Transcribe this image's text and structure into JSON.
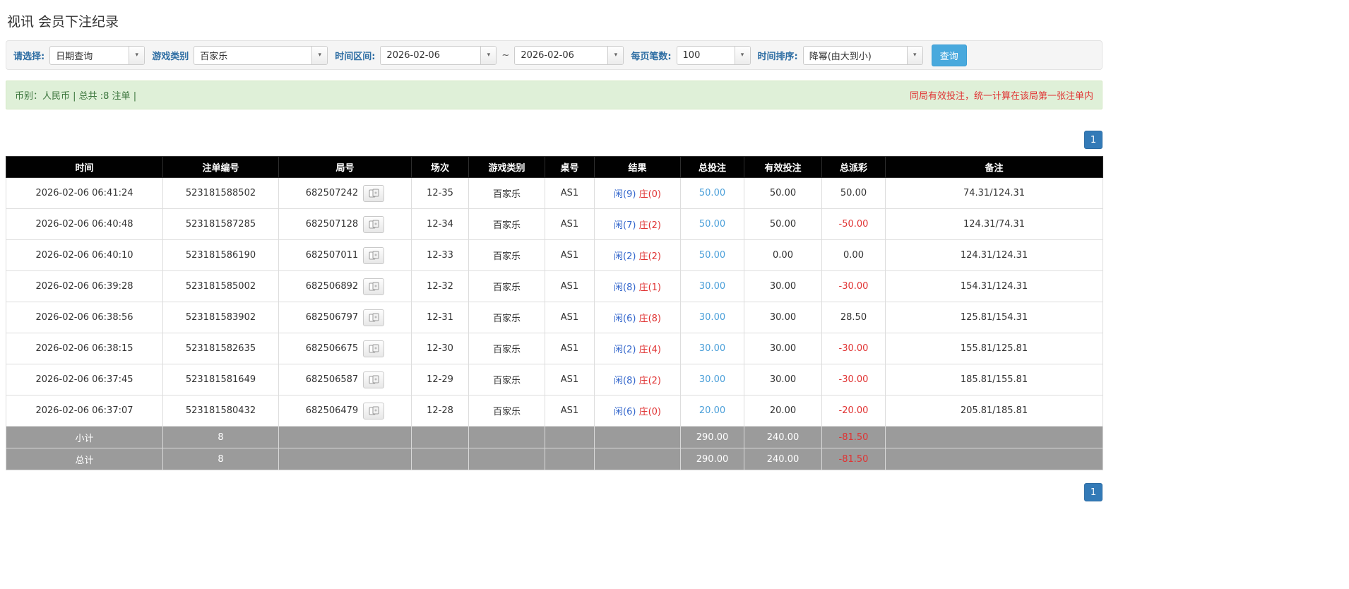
{
  "page": {
    "title": "视讯 会员下注纪录"
  },
  "filters": {
    "select_label": "请选择:",
    "select_value": "日期查询",
    "game_type_label": "游戏类别",
    "game_type_value": "百家乐",
    "date_range_label": "时间区间:",
    "date_from": "2026-02-06",
    "date_separator": "~",
    "date_to": "2026-02-06",
    "page_size_label": "每页笔数:",
    "page_size_value": "100",
    "sort_label": "时间排序:",
    "sort_value": "降幂(由大到小)",
    "search_button": "查询"
  },
  "summary": {
    "currency_info": "币别：人民币 | 总共 :8 注单 |",
    "note": "同局有效投注，统一计算在该局第一张注单内"
  },
  "pagination": {
    "page": "1"
  },
  "table": {
    "headers": [
      "时间",
      "注单编号",
      "局号",
      "场次",
      "游戏类别",
      "桌号",
      "结果",
      "总投注",
      "有效投注",
      "总派彩",
      "备注"
    ],
    "rows": [
      {
        "time": "2026-02-06 06:41:24",
        "bet_id": "523181588502",
        "round_id": "682507242",
        "session": "12-35",
        "game": "百家乐",
        "table_no": "AS1",
        "result_player": "闲(9)",
        "result_banker": "庄(0)",
        "total_bet": "50.00",
        "valid_bet": "50.00",
        "payout": "50.00",
        "note": "74.31/124.31",
        "highlighted": false
      },
      {
        "time": "2026-02-06 06:40:48",
        "bet_id": "523181587285",
        "round_id": "682507128",
        "session": "12-34",
        "game": "百家乐",
        "table_no": "AS1",
        "result_player": "闲(7)",
        "result_banker": "庄(2)",
        "total_bet": "50.00",
        "valid_bet": "50.00",
        "payout": "-50.00",
        "note": "124.31/74.31",
        "highlighted": false
      },
      {
        "time": "2026-02-06 06:40:10",
        "bet_id": "523181586190",
        "round_id": "682507011",
        "session": "12-33",
        "game": "百家乐",
        "table_no": "AS1",
        "result_player": "闲(2)",
        "result_banker": "庄(2)",
        "total_bet": "50.00",
        "valid_bet": "0.00",
        "payout": "0.00",
        "note": "124.31/124.31",
        "highlighted": false
      },
      {
        "time": "2026-02-06 06:39:28",
        "bet_id": "523181585002",
        "round_id": "682506892",
        "session": "12-32",
        "game": "百家乐",
        "table_no": "AS1",
        "result_player": "闲(8)",
        "result_banker": "庄(1)",
        "total_bet": "30.00",
        "valid_bet": "30.00",
        "payout": "-30.00",
        "note": "154.31/124.31",
        "highlighted": false
      },
      {
        "time": "2026-02-06 06:38:56",
        "bet_id": "523181583902",
        "round_id": "682506797",
        "session": "12-31",
        "game": "百家乐",
        "table_no": "AS1",
        "result_player": "闲(6)",
        "result_banker": "庄(8)",
        "total_bet": "30.00",
        "valid_bet": "30.00",
        "payout": "28.50",
        "note": "125.81/154.31",
        "highlighted": false
      },
      {
        "time": "2026-02-06 06:38:15",
        "bet_id": "523181582635",
        "round_id": "682506675",
        "session": "12-30",
        "game": "百家乐",
        "table_no": "AS1",
        "result_player": "闲(2)",
        "result_banker": "庄(4)",
        "total_bet": "30.00",
        "valid_bet": "30.00",
        "payout": "-30.00",
        "note": "155.81/125.81",
        "highlighted": true
      },
      {
        "time": "2026-02-06 06:37:45",
        "bet_id": "523181581649",
        "round_id": "682506587",
        "session": "12-29",
        "game": "百家乐",
        "table_no": "AS1",
        "result_player": "闲(8)",
        "result_banker": "庄(2)",
        "total_bet": "30.00",
        "valid_bet": "30.00",
        "payout": "-30.00",
        "note": "185.81/155.81",
        "highlighted": false
      },
      {
        "time": "2026-02-06 06:37:07",
        "bet_id": "523181580432",
        "round_id": "682506479",
        "session": "12-28",
        "game": "百家乐",
        "table_no": "AS1",
        "result_player": "闲(6)",
        "result_banker": "庄(0)",
        "total_bet": "20.00",
        "valid_bet": "20.00",
        "payout": "-20.00",
        "note": "205.81/185.81",
        "highlighted": false
      }
    ],
    "subtotal": {
      "label": "小计",
      "count": "8",
      "total_bet": "290.00",
      "valid_bet": "240.00",
      "payout": "-81.50"
    },
    "total": {
      "label": "总计",
      "count": "8",
      "total_bet": "290.00",
      "valid_bet": "240.00",
      "payout": "-81.50"
    }
  }
}
